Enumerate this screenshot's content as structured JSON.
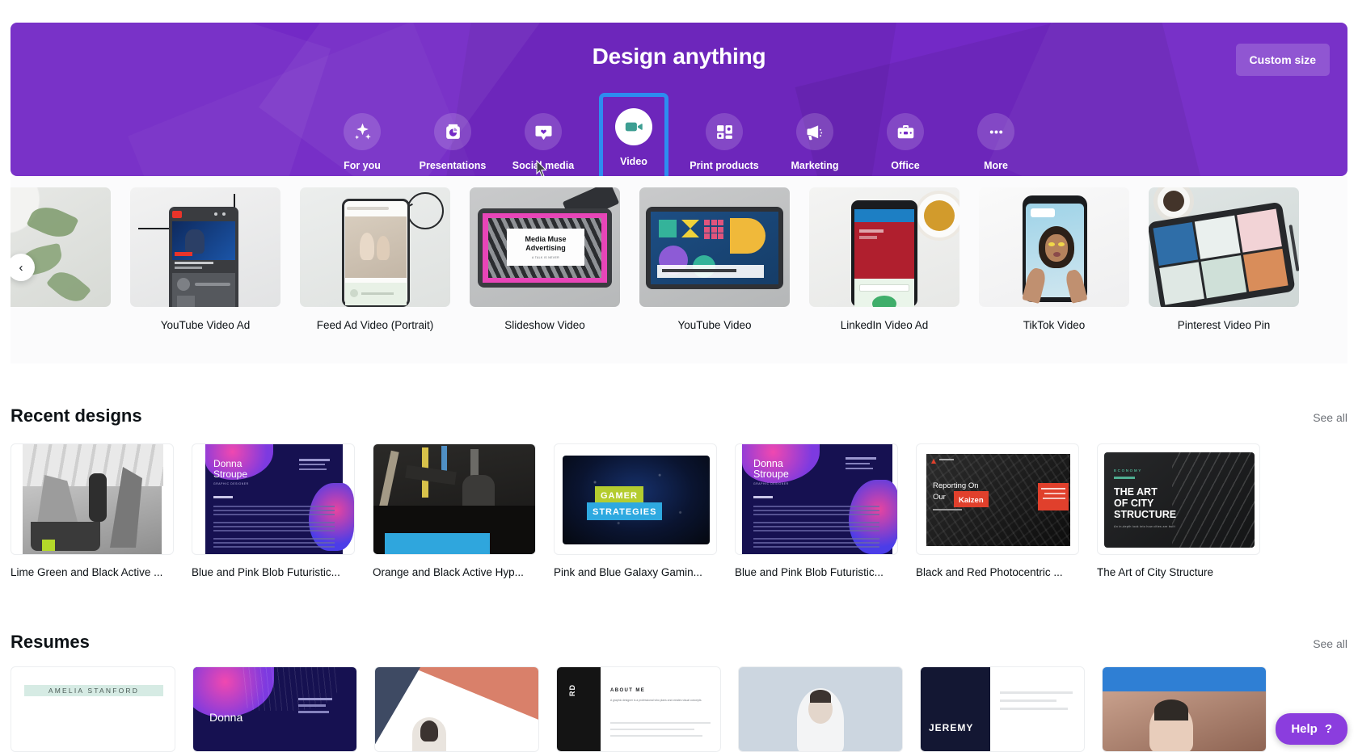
{
  "hero": {
    "title": "Design anything",
    "custom_size_label": "Custom size",
    "background_color": "#7329c6",
    "selected_highlight_color": "#2d8cf0",
    "categories": [
      {
        "label": "For you",
        "icon": "sparkle-icon",
        "selected": false
      },
      {
        "label": "Presentations",
        "icon": "presentation-chart-icon",
        "selected": false
      },
      {
        "label": "Social media",
        "icon": "speech-bubble-heart-icon",
        "selected": false
      },
      {
        "label": "Video",
        "icon": "video-camera-icon",
        "selected": true
      },
      {
        "label": "Print products",
        "icon": "print-products-icon",
        "selected": false
      },
      {
        "label": "Marketing",
        "icon": "megaphone-icon",
        "selected": false
      },
      {
        "label": "Office",
        "icon": "briefcase-icon",
        "selected": false
      },
      {
        "label": "More",
        "icon": "ellipsis-icon",
        "selected": false
      }
    ]
  },
  "template_carousel": {
    "prev_label": "‹",
    "items": [
      {
        "name": ""
      },
      {
        "name": "YouTube Video Ad"
      },
      {
        "name": "Feed Ad Video (Portrait)"
      },
      {
        "name": "Slideshow Video"
      },
      {
        "name": "YouTube Video"
      },
      {
        "name": "LinkedIn Video Ad"
      },
      {
        "name": "TikTok Video"
      },
      {
        "name": "Pinterest Video Pin"
      }
    ],
    "thumb_text": {
      "slideshow_line1": "Media Muse",
      "slideshow_line2": "Advertising",
      "slideshow_line3": "A TALK IS NEVER"
    }
  },
  "recent_designs": {
    "title": "Recent designs",
    "see_all_label": "See all",
    "next_label": "›",
    "items": [
      {
        "name": "Lime Green and Black Active ..."
      },
      {
        "name": "Blue and Pink Blob Futuristic..."
      },
      {
        "name": "Orange and Black Active Hyp..."
      },
      {
        "name": "Pink and Blue Galaxy Gamin..."
      },
      {
        "name": "Blue and Pink Blob Futuristic..."
      },
      {
        "name": "Black and Red Photocentric ..."
      },
      {
        "name": "The Art of City Structure"
      }
    ],
    "thumb_text": {
      "donna_first": "Donna",
      "donna_last": "Stroupe",
      "donna_role": "GRAPHIC DESIGNER",
      "gamer_line1": "GAMER",
      "gamer_line2": "STRATEGIES",
      "kaizen_line1": "Reporting On",
      "kaizen_line2": "Our",
      "kaizen_highlight": "Kaizen",
      "city_eyebrow": "ECONOMY",
      "city_line1": "THE ART",
      "city_line2": "OF CITY",
      "city_line3": "STRUCTURE",
      "city_sub": "An in-depth look into how cities are built"
    }
  },
  "resumes": {
    "title": "Resumes",
    "see_all_label": "See all",
    "items": [
      {
        "name": "AMELIA STANFORD"
      },
      {
        "name": "Donna Stroupe"
      },
      {
        "name": ""
      },
      {
        "name": "ABOUT ME"
      },
      {
        "name": ""
      },
      {
        "name": "JEREMY"
      },
      {
        "name": ""
      }
    ],
    "thumb_text": {
      "amelia": "AMELIA STANFORD",
      "donna_first": "Donna",
      "about_me": "ABOUT ME",
      "about_body": "A graphic designer is a professional who plans and creates visual concepts",
      "jeremy": "JEREMY",
      "card4_side": "RD"
    }
  },
  "help": {
    "label": "Help",
    "glyph": "?",
    "color": "#8b3dde"
  }
}
